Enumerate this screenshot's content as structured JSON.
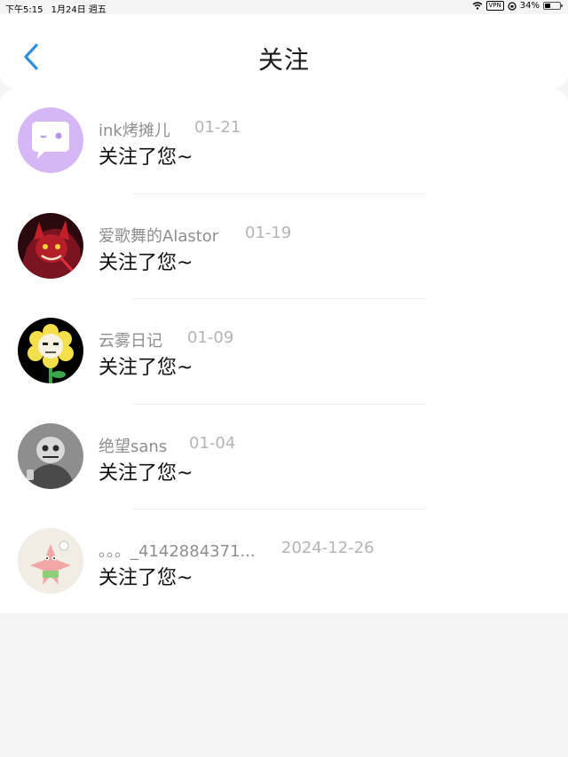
{
  "status_bar": {
    "time": "下午5:15",
    "date": "1月24日 週五",
    "vpn": "VPN",
    "battery": "34%",
    "battery_level": 0.34
  },
  "header": {
    "title": "关注",
    "back_icon": "chevron-left-icon",
    "accent_color": "#2f8fde"
  },
  "notifications": [
    {
      "name": "ink烤摊儿",
      "date": "01-21",
      "message": "关注了您~"
    },
    {
      "name": "爱歌舞的Alastor",
      "date": "01-19",
      "message": "关注了您~"
    },
    {
      "name": "云雾日记",
      "date": "01-09",
      "message": "关注了您~"
    },
    {
      "name": "绝望sans",
      "date": "01-04",
      "message": "关注了您~"
    },
    {
      "name": "。。。_4142884371...",
      "date": "2024-12-26",
      "message": "关注了您~"
    }
  ]
}
